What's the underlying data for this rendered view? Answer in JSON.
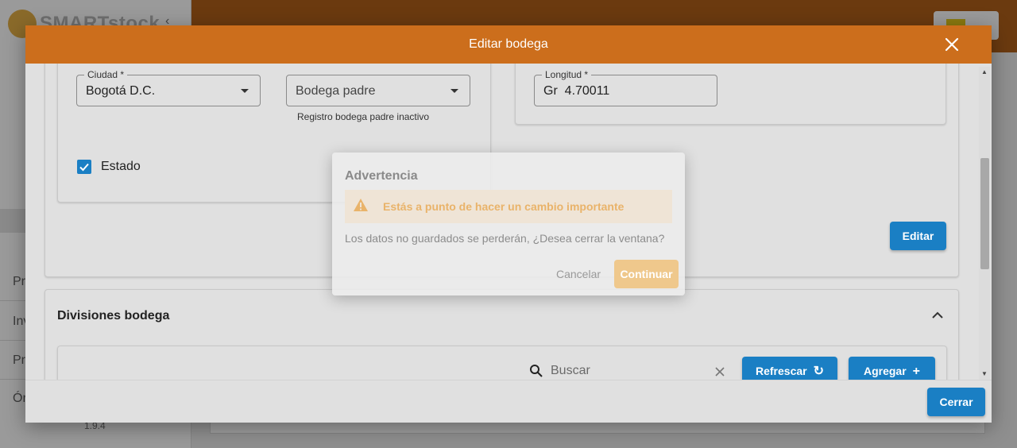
{
  "app": {
    "logo_text": "SMARTstock",
    "sidebar_items": [
      "Pr",
      "Inv",
      "Pr",
      "Ór"
    ],
    "version": "1.9.4"
  },
  "modal": {
    "title": "Editar bodega",
    "close_icon": "close-icon",
    "ciudad": {
      "label": "Ciudad *",
      "value": "Bogotá D.C."
    },
    "bodega_padre": {
      "placeholder": "Bodega padre",
      "help": "Registro bodega padre inactivo"
    },
    "longitud": {
      "label": "Longitud *",
      "value": "Gr  4.70011"
    },
    "estado": {
      "label": "Estado",
      "checked": true
    },
    "edit_button": "Editar",
    "divisiones": {
      "title": "Divisiones bodega",
      "search_placeholder": "Buscar",
      "refresh_button": "Refrescar",
      "add_button": "Agregar"
    },
    "footer": {
      "close_button": "Cerrar"
    }
  },
  "dialog": {
    "title": "Advertencia",
    "alert_text": "Estás a punto de hacer un cambio importante",
    "message": "Los datos no guardados se perderán, ¿Desea cerrar la ventana?",
    "cancel_button": "Cancelar",
    "continue_button": "Continuar"
  },
  "colors": {
    "header": "#cc6e1c",
    "primary_button": "#1a7fc4",
    "warning_text": "#e9b36a",
    "continue_button": "#efc88c"
  }
}
